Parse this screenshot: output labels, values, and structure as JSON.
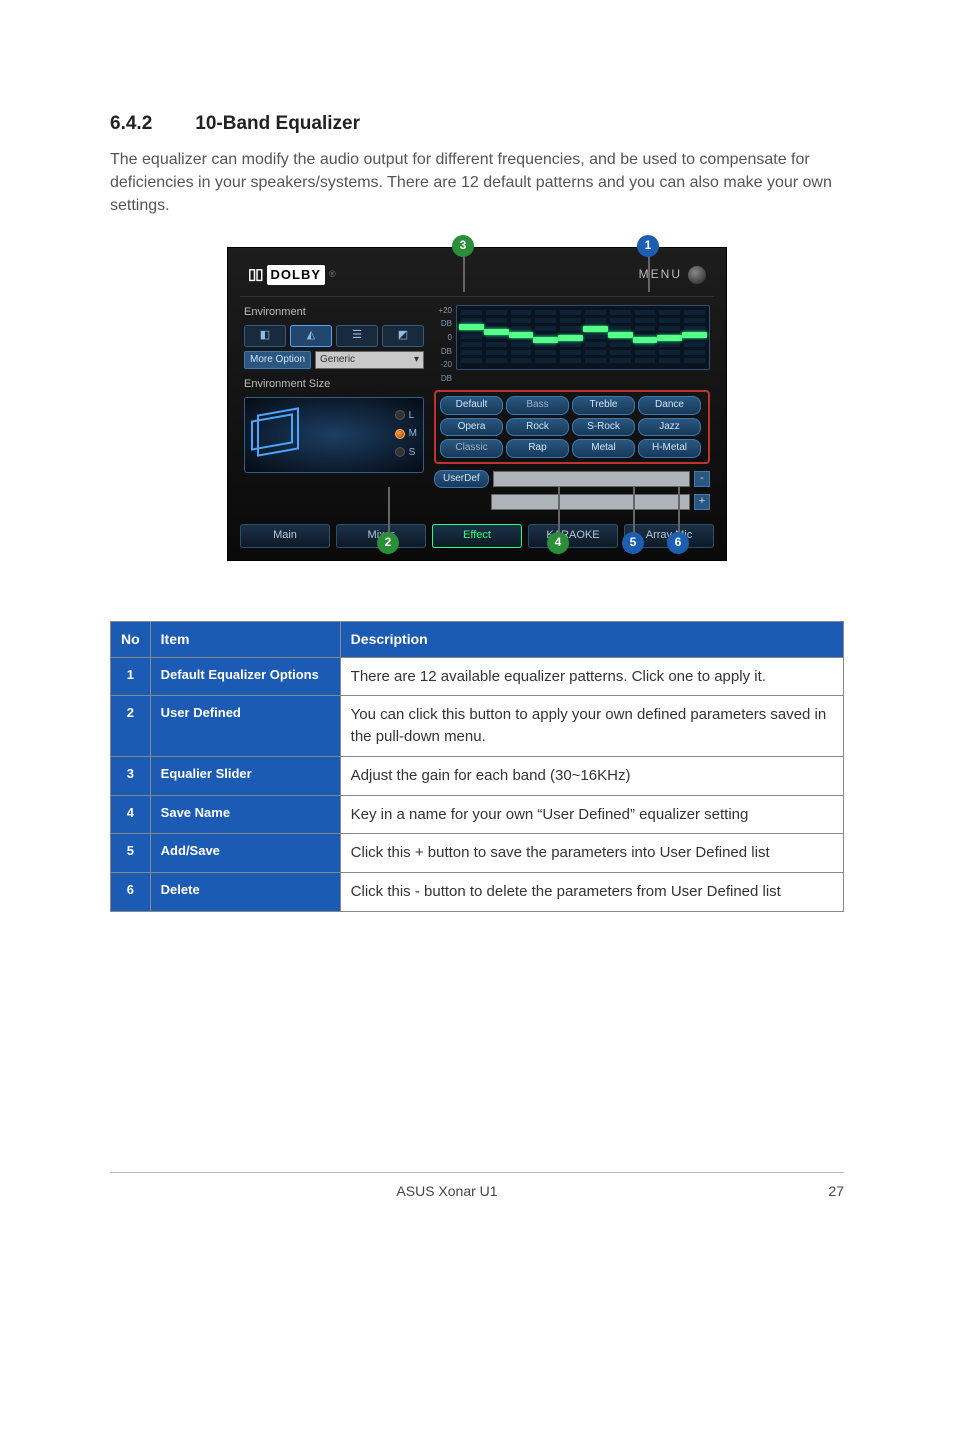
{
  "section": {
    "number": "6.4.2",
    "title": "10-Band Equalizer"
  },
  "intro": "The equalizer can modify the audio output for different frequencies, and be used to compensate for deficiencies in your speakers/systems. There are 12 default patterns and you can also make your own settings.",
  "bubbles": {
    "b1": "1",
    "b2": "2",
    "b3": "3",
    "b4": "4",
    "b5": "5",
    "b6": "6"
  },
  "panel": {
    "dolby_label": "DOLBY",
    "dolby_r": "®",
    "menu_label": "MENU",
    "env": {
      "title": "Environment",
      "more_option": "More Option",
      "dropdown_value": "Generic",
      "size_title": "Environment Size",
      "size_L": "L",
      "size_M": "M",
      "size_S": "S",
      "size_M_indicator": "M"
    },
    "axis": {
      "a1": "+20",
      "a2": "DB",
      "a3": "0",
      "a4": "DB",
      "a5": "-20",
      "a6": "DB"
    },
    "presets": [
      "Default",
      "Bass",
      "Treble",
      "Dance",
      "Opera",
      "Rock",
      "S-Rock",
      "Jazz",
      "Classic",
      "Rap",
      "Metal",
      "H-Metal"
    ],
    "userdef": "UserDef",
    "sq_minus": "-",
    "sq_plus": "+",
    "tabs": [
      "Main",
      "Mixer",
      "Effect",
      "KARAOKE",
      "Array Mic"
    ]
  },
  "table": {
    "head_no": "No",
    "head_item": "Item",
    "head_desc": "Description",
    "rows": [
      {
        "no": "1",
        "item": "Default Equalizer Options",
        "desc": "There are 12 available equalizer patterns. Click one to apply it."
      },
      {
        "no": "2",
        "item": "User Defined",
        "desc": "You can click this button to apply your own defined parameters saved in the pull-down menu."
      },
      {
        "no": "3",
        "item": "Equalier Slider",
        "desc": "Adjust the gain for each band (30~16KHz)"
      },
      {
        "no": "4",
        "item": "Save Name",
        "desc": "Key in a name for your own “User Defined” equalizer setting"
      },
      {
        "no": "5",
        "item": "Add/Save",
        "desc": "Click this + button to save the parameters into User Defined list"
      },
      {
        "no": "6",
        "item": "Delete",
        "desc": "Click this - button to delete the parameters from User Defined list"
      }
    ]
  },
  "footer": {
    "product": "ASUS Xonar U1",
    "page": "27"
  }
}
